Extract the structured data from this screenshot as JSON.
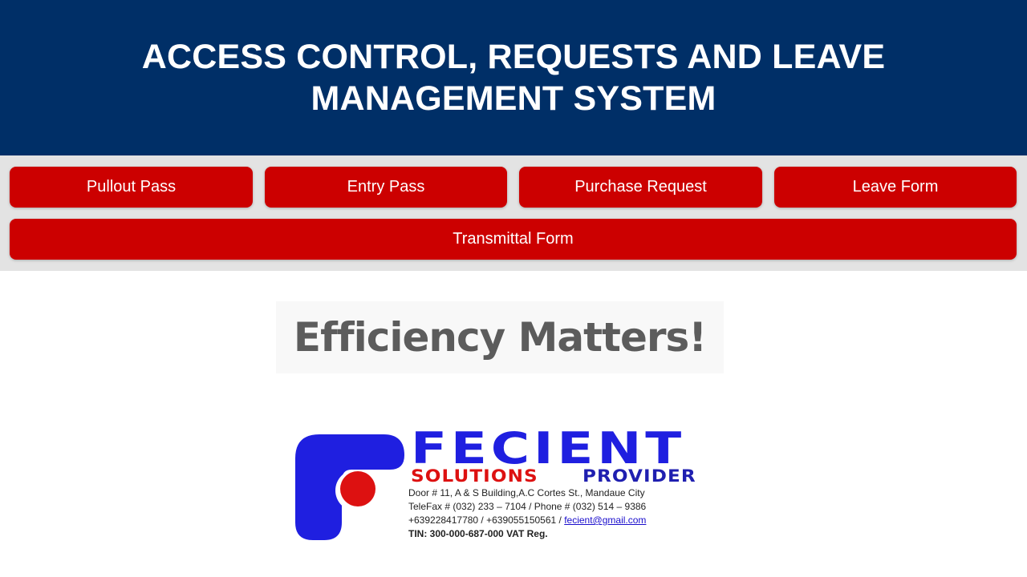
{
  "header": {
    "title": "ACCESS CONTROL, REQUESTS AND LEAVE MANAGEMENT SYSTEM",
    "background": "#002f67"
  },
  "nav": {
    "buttons": [
      {
        "label": "Pullout Pass"
      },
      {
        "label": "Entry Pass"
      },
      {
        "label": "Purchase Request"
      },
      {
        "label": "Leave Form"
      },
      {
        "label": "Transmittal Form"
      }
    ],
    "button_color": "#cc0000"
  },
  "tagline": "Efficiency Matters!",
  "logo": {
    "brand": "FECIENT",
    "sub_red": "SOLUTIONS",
    "sub_blue": "PROVIDER",
    "address": "Door # 11, A & S Building,A.C Cortes St., Mandaue City",
    "phone": "TeleFax # (032) 233 – 7104 / Phone # (032) 514 – 9386",
    "mobile": "+639228417780 / +639055150561 / ",
    "email": "fecient@gmail.com",
    "tin": "TIN: 300-000-687-000 VAT Reg.",
    "colors": {
      "blue": "#1f1fe0",
      "red": "#dd1111"
    }
  }
}
